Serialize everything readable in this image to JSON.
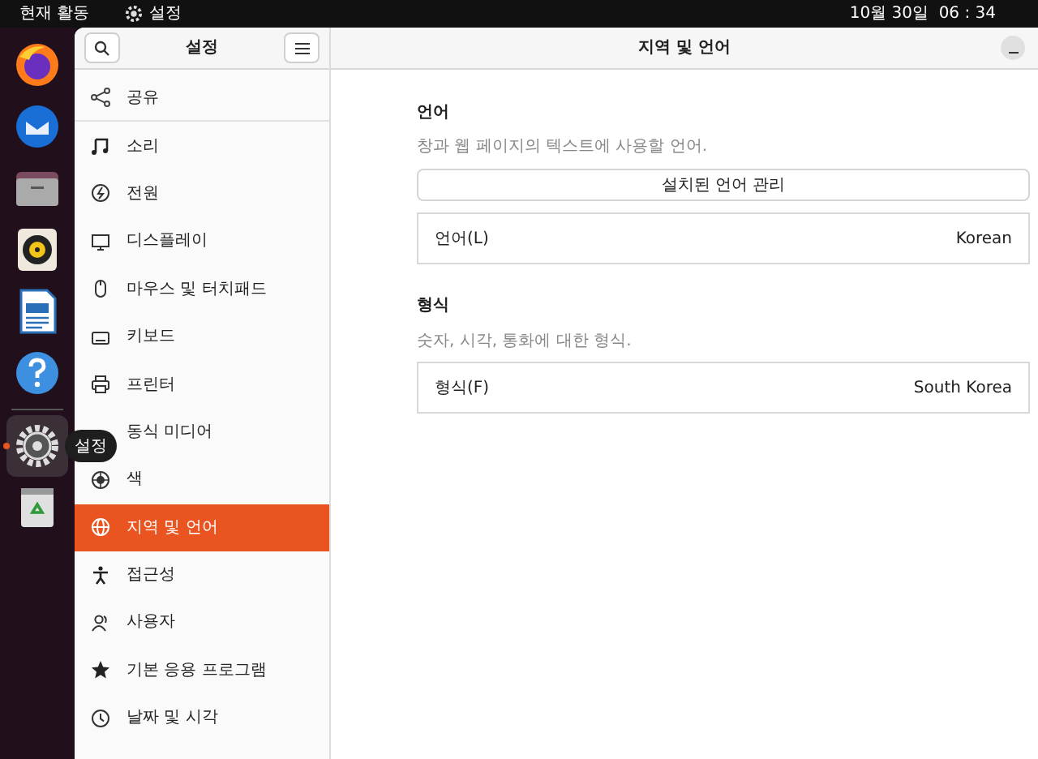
{
  "top_bar": {
    "activities": "현재 활동",
    "app_name": "설정",
    "clock": "10월 30일  06 : 34"
  },
  "dock": [
    {
      "kind": "firefox",
      "running": false
    },
    {
      "kind": "thunderbird",
      "running": false
    },
    {
      "kind": "files",
      "running": false
    },
    {
      "kind": "rhythmbox",
      "running": false
    },
    {
      "kind": "writer",
      "running": false
    },
    {
      "kind": "help",
      "running": false
    },
    {
      "kind": "settings",
      "running": true
    },
    {
      "kind": "trash",
      "running": false
    }
  ],
  "dock_tooltip": "설정",
  "sidebar": {
    "title": "설정",
    "items": [
      {
        "kind": "share",
        "label": "공유",
        "selected": false
      },
      {
        "kind": "music",
        "label": "소리",
        "selected": false
      },
      {
        "kind": "power",
        "label": "전원",
        "selected": false
      },
      {
        "kind": "display",
        "label": "디스플레이",
        "selected": false
      },
      {
        "kind": "mouse",
        "label": "마우스 및 터치패드",
        "selected": false
      },
      {
        "kind": "keyboard",
        "label": "키보드",
        "selected": false
      },
      {
        "kind": "printer",
        "label": "프린터",
        "selected": false
      },
      {
        "kind": "media",
        "label": "동식 미디어",
        "selected": false
      },
      {
        "kind": "color",
        "label": "색",
        "selected": false
      },
      {
        "kind": "globe",
        "label": "지역 및 언어",
        "selected": true
      },
      {
        "kind": "access",
        "label": "접근성",
        "selected": false
      },
      {
        "kind": "users",
        "label": "사용자",
        "selected": false
      },
      {
        "kind": "star",
        "label": "기본 응용 프로그램",
        "selected": false
      },
      {
        "kind": "clock",
        "label": "날짜 및 시각",
        "selected": false
      }
    ]
  },
  "content": {
    "title": "지역 및 언어",
    "language": {
      "heading": "언어",
      "description": "창과 웹 페이지의 텍스트에 사용할 언어.",
      "manage_button": "설치된 언어 관리",
      "row_label": "언어(L)",
      "row_value": "Korean"
    },
    "formats": {
      "heading": "형식",
      "description": "숫자, 시각, 통화에 대한 형식.",
      "row_label": "형식(F)",
      "row_value": "South Korea"
    }
  }
}
